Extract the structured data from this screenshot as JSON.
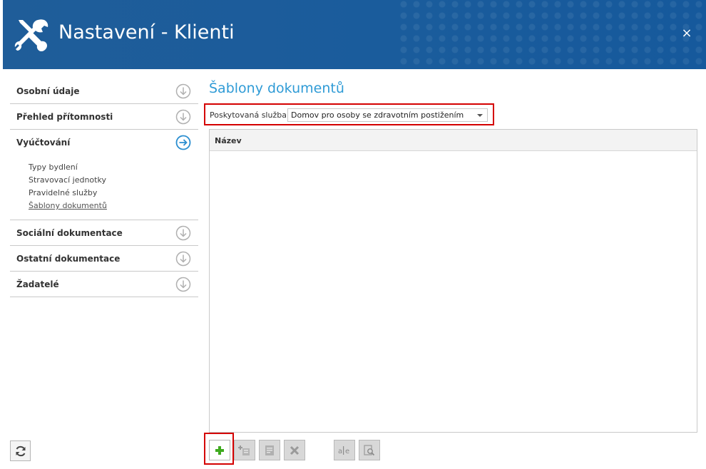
{
  "window": {
    "title": "Nastavení - Klienti",
    "close_glyph": "×",
    "icon": "wrench-screwdriver-icon",
    "header_color": "#1a5c9c"
  },
  "sidebar": {
    "items": [
      {
        "label": "Osobní údaje",
        "icon": "arrow-down-circle-icon"
      },
      {
        "label": "Přehled přítomnosti",
        "icon": "arrow-down-circle-icon"
      },
      {
        "label": "Vyúčtování",
        "icon": "arrow-right-circle-icon",
        "expanded": true
      },
      {
        "label": "Sociální dokumentace",
        "icon": "arrow-down-circle-icon"
      },
      {
        "label": "Ostatní dokumentace",
        "icon": "arrow-down-circle-icon"
      },
      {
        "label": "Žadatelé",
        "icon": "arrow-down-circle-icon"
      }
    ],
    "subitems": [
      {
        "label": "Typy bydlení"
      },
      {
        "label": "Stravovací jednotky"
      },
      {
        "label": "Pravidelné služby"
      },
      {
        "label": "Šablony dokumentů",
        "active": true
      }
    ],
    "refresh_icon": "refresh-icon"
  },
  "main": {
    "title": "Šablony dokumentů",
    "title_color": "#2f9bd6",
    "filter": {
      "label": "Poskytovaná služba:",
      "value": "Domov pro osoby se zdravotním postižením"
    },
    "grid": {
      "columns": [
        "Název"
      ],
      "rows": []
    },
    "toolbar": [
      {
        "name": "add-button",
        "icon": "plus-icon",
        "enabled": true
      },
      {
        "name": "add-copy-button",
        "icon": "add-copy-icon",
        "enabled": false
      },
      {
        "name": "edit-button",
        "icon": "edit-document-icon",
        "enabled": false
      },
      {
        "name": "delete-button",
        "icon": "delete-x-icon",
        "enabled": false
      },
      {
        "name": "rename-button",
        "icon": "text-edit-icon",
        "enabled": false
      },
      {
        "name": "preview-button",
        "icon": "preview-magnifier-icon",
        "enabled": false
      }
    ],
    "highlight_color": "#d40000"
  }
}
